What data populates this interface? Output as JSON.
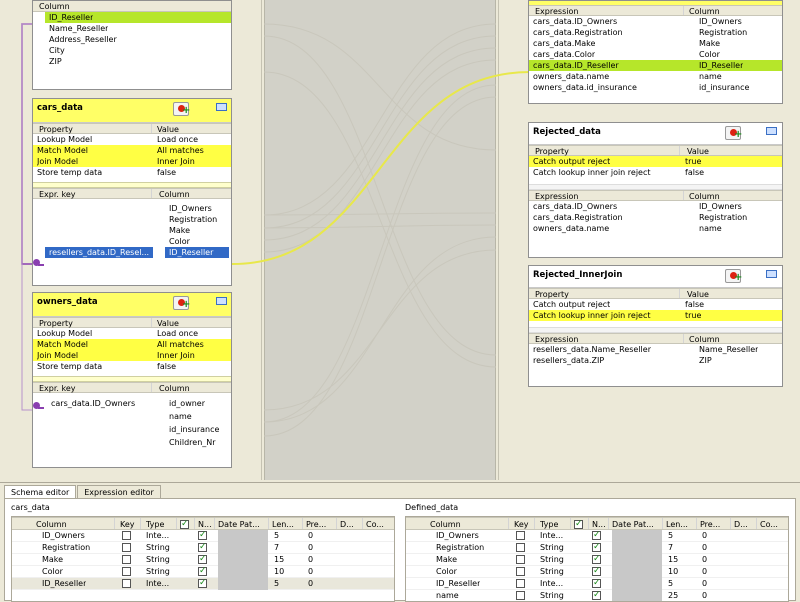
{
  "resellers_table": {
    "column_header": "Column",
    "rows": [
      "ID_Reseller",
      "Name_Reseller",
      "Address_Reseller",
      "City",
      "ZIP"
    ]
  },
  "cars_data": {
    "title": "cars_data",
    "prop_headers": [
      "Property",
      "Value"
    ],
    "props": [
      [
        "Lookup Model",
        "Load once"
      ],
      [
        "Match Model",
        "All matches"
      ],
      [
        "Join Model",
        "Inner Join"
      ],
      [
        "Store temp data",
        "false"
      ]
    ],
    "key_headers": [
      "Expr. key",
      "Column"
    ],
    "columns": [
      "ID_Owners",
      "Registration",
      "Make",
      "Color",
      "ID_Reseller"
    ],
    "expr_key": "resellers_data.ID_Resel..."
  },
  "owners_data": {
    "title": "owners_data",
    "prop_headers": [
      "Property",
      "Value"
    ],
    "props": [
      [
        "Lookup Model",
        "Load once"
      ],
      [
        "Match Model",
        "All matches"
      ],
      [
        "Join Model",
        "Inner Join"
      ],
      [
        "Store temp data",
        "false"
      ]
    ],
    "key_headers": [
      "Expr. key",
      "Column"
    ],
    "expr_key": "cars_data.ID_Owners",
    "columns": [
      "id_owner",
      "name",
      "id_insurance",
      "Children_Nr"
    ]
  },
  "defined_out": {
    "headers": [
      "Expression",
      "Column"
    ],
    "rows": [
      [
        "cars_data.ID_Owners",
        "ID_Owners"
      ],
      [
        "cars_data.Registration",
        "Registration"
      ],
      [
        "cars_data.Make",
        "Make"
      ],
      [
        "cars_data.Color",
        "Color"
      ],
      [
        "cars_data.ID_Reseller",
        "ID_Reseller"
      ],
      [
        "owners_data.name",
        "name"
      ],
      [
        "owners_data.id_insurance",
        "id_insurance"
      ]
    ]
  },
  "rejected_data": {
    "title": "Rejected_data",
    "prop_headers": [
      "Property",
      "Value"
    ],
    "props": [
      [
        "Catch output reject",
        "true"
      ],
      [
        "Catch lookup inner join reject",
        "false"
      ]
    ],
    "headers": [
      "Expression",
      "Column"
    ],
    "rows": [
      [
        "cars_data.ID_Owners",
        "ID_Owners"
      ],
      [
        "cars_data.Registration",
        "Registration"
      ],
      [
        "owners_data.name",
        "name"
      ]
    ]
  },
  "rejected_inner": {
    "title": "Rejected_InnerJoin",
    "prop_headers": [
      "Property",
      "Value"
    ],
    "props": [
      [
        "Catch output reject",
        "false"
      ],
      [
        "Catch lookup inner join reject",
        "true"
      ]
    ],
    "headers": [
      "Expression",
      "Column"
    ],
    "rows": [
      [
        "resellers_data.Name_Reseller",
        "Name_Reseller"
      ],
      [
        "resellers_data.ZIP",
        "ZIP"
      ]
    ]
  },
  "bottom": {
    "tabs": [
      "Schema editor",
      "Expression editor"
    ],
    "left_label": "cars_data",
    "right_label": "Defined_data",
    "headers": [
      "Column",
      "Key",
      "Type",
      "",
      "N...",
      "Date Pat...",
      "Len...",
      "Pre...",
      "D...",
      "Co..."
    ],
    "left_rows": [
      [
        "ID_Owners",
        "Inte...",
        "5",
        "0"
      ],
      [
        "Registration",
        "String",
        "7",
        "0"
      ],
      [
        "Make",
        "String",
        "15",
        "0"
      ],
      [
        "Color",
        "String",
        "10",
        "0"
      ],
      [
        "ID_Reseller",
        "Inte...",
        "5",
        "0"
      ]
    ],
    "right_rows": [
      [
        "ID_Owners",
        "Inte...",
        "5",
        "0"
      ],
      [
        "Registration",
        "String",
        "7",
        "0"
      ],
      [
        "Make",
        "String",
        "15",
        "0"
      ],
      [
        "Color",
        "String",
        "10",
        "0"
      ],
      [
        "ID_Reseller",
        "Inte...",
        "5",
        "0"
      ],
      [
        "name",
        "String",
        "25",
        "0"
      ]
    ]
  },
  "colors": {
    "header_yellow": "#ffff66",
    "highlight_yellow": "#ffff44",
    "highlight_green": "#b6e62a",
    "selection_blue": "#3169c6",
    "link_yellow": "#e8e84a",
    "key_purple": "#8a3fb0"
  }
}
